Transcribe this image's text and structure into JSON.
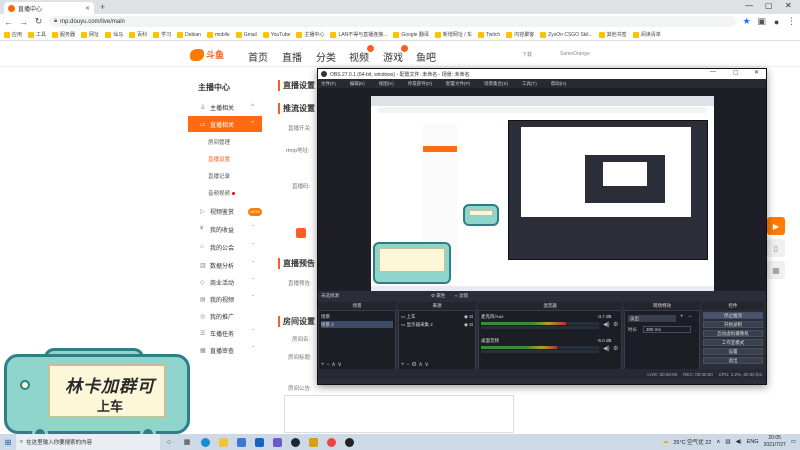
{
  "browser": {
    "tab_title": "直播中心",
    "url": "mp.douyu.com/live/main",
    "bookmarks": [
      "应用",
      "工具",
      "服务器",
      "网址",
      "仙马",
      "百科",
      "学习",
      "Debian",
      "mobile",
      "Gmail",
      "YouTube",
      "主播中心",
      "LAN不得与直播连接...",
      "Google 翻译",
      "新增网址 / 东",
      "Twitch",
      "内容聚客",
      "ZyxOn CSGO Skil...",
      "其他书签",
      "阅读清单"
    ]
  },
  "site": {
    "logo_text": "斗鱼",
    "nav": [
      "首页",
      "直播",
      "分类",
      "视频",
      "游戏",
      "鱼吧"
    ],
    "header_right": [
      "下载",
      "SameOrange"
    ]
  },
  "sidebar": {
    "title": "主播中心",
    "items": [
      {
        "label": "主播相关",
        "icon": "user-icon"
      },
      {
        "label": "直播相关",
        "icon": "live-icon"
      },
      {
        "label": "视频鉴赏",
        "icon": "video-icon"
      },
      {
        "label": "我的收益",
        "icon": "money-icon"
      },
      {
        "label": "我的公会",
        "icon": "guild-icon"
      },
      {
        "label": "数据分析",
        "icon": "chart-icon"
      },
      {
        "label": "商业活动",
        "icon": "business-icon"
      },
      {
        "label": "我的视频",
        "icon": "film-icon"
      },
      {
        "label": "我的推广",
        "icon": "promote-icon"
      },
      {
        "label": "车播任务",
        "icon": "task-icon"
      },
      {
        "label": "直播审查",
        "icon": "review-icon"
      }
    ],
    "subitems": [
      "房间管理",
      "直播设置",
      "直播记录",
      "音频视频"
    ],
    "new_tag": "NEW"
  },
  "content": {
    "section1": "直播设置",
    "section1_sub": "推流设置",
    "labels1": [
      "直播开关:",
      "rtmp地址:",
      "直播码:"
    ],
    "section2": "直播预告",
    "labels2": [
      "直播预告:"
    ],
    "section3": "房间设置",
    "labels3": [
      "房间名:",
      "房间标题:",
      "房间公告:"
    ]
  },
  "obs": {
    "title": "OBS 27.0.1 (64-bit, windows) - 配置文件: 未命名 - 场景: 未命名",
    "menu": [
      "文件(F)",
      "编辑(E)",
      "视图(V)",
      "停靠部件(D)",
      "配置文件(P)",
      "场景集合(S)",
      "工具(T)",
      "帮助(H)"
    ],
    "no_source": "未选择源",
    "props_label": "属性",
    "filter_label": "滤镜",
    "dock_headers": [
      "场景",
      "来源",
      "混音器",
      "转场特效",
      "控件"
    ],
    "scenes": [
      "场景",
      "场景 2"
    ],
    "sources": [
      "上车",
      "显示器采集 2"
    ],
    "mixer": [
      {
        "name": "麦克风/Aux",
        "db": "-3.7 dB",
        "level": 0.72
      },
      {
        "name": "桌面音频",
        "db": "-5.0 dB",
        "level": 0.64
      }
    ],
    "transition": "淡出",
    "duration_label": "时长",
    "duration": "300 ms",
    "controls": [
      "停止推流",
      "开始录制",
      "启动虚拟摄像机",
      "工作室模式",
      "设置",
      "退出"
    ],
    "status": [
      "LIVE: 00:00:00",
      "REC: 00:00:00",
      "CPU: 1.2%, 60.00 fps"
    ]
  },
  "sticker": {
    "line1": "林卡加群可",
    "line2": "上车"
  },
  "taskbar": {
    "search": "在这里输入你要搜索的内容",
    "weather": "25°C 空气优 22",
    "lang": "ENG",
    "time": "20:05",
    "date": "2021/7/27"
  },
  "colors": {
    "accent": "#ff6a13",
    "obs_bg": "#2b2e38",
    "sticker": "#8fd5cc"
  }
}
